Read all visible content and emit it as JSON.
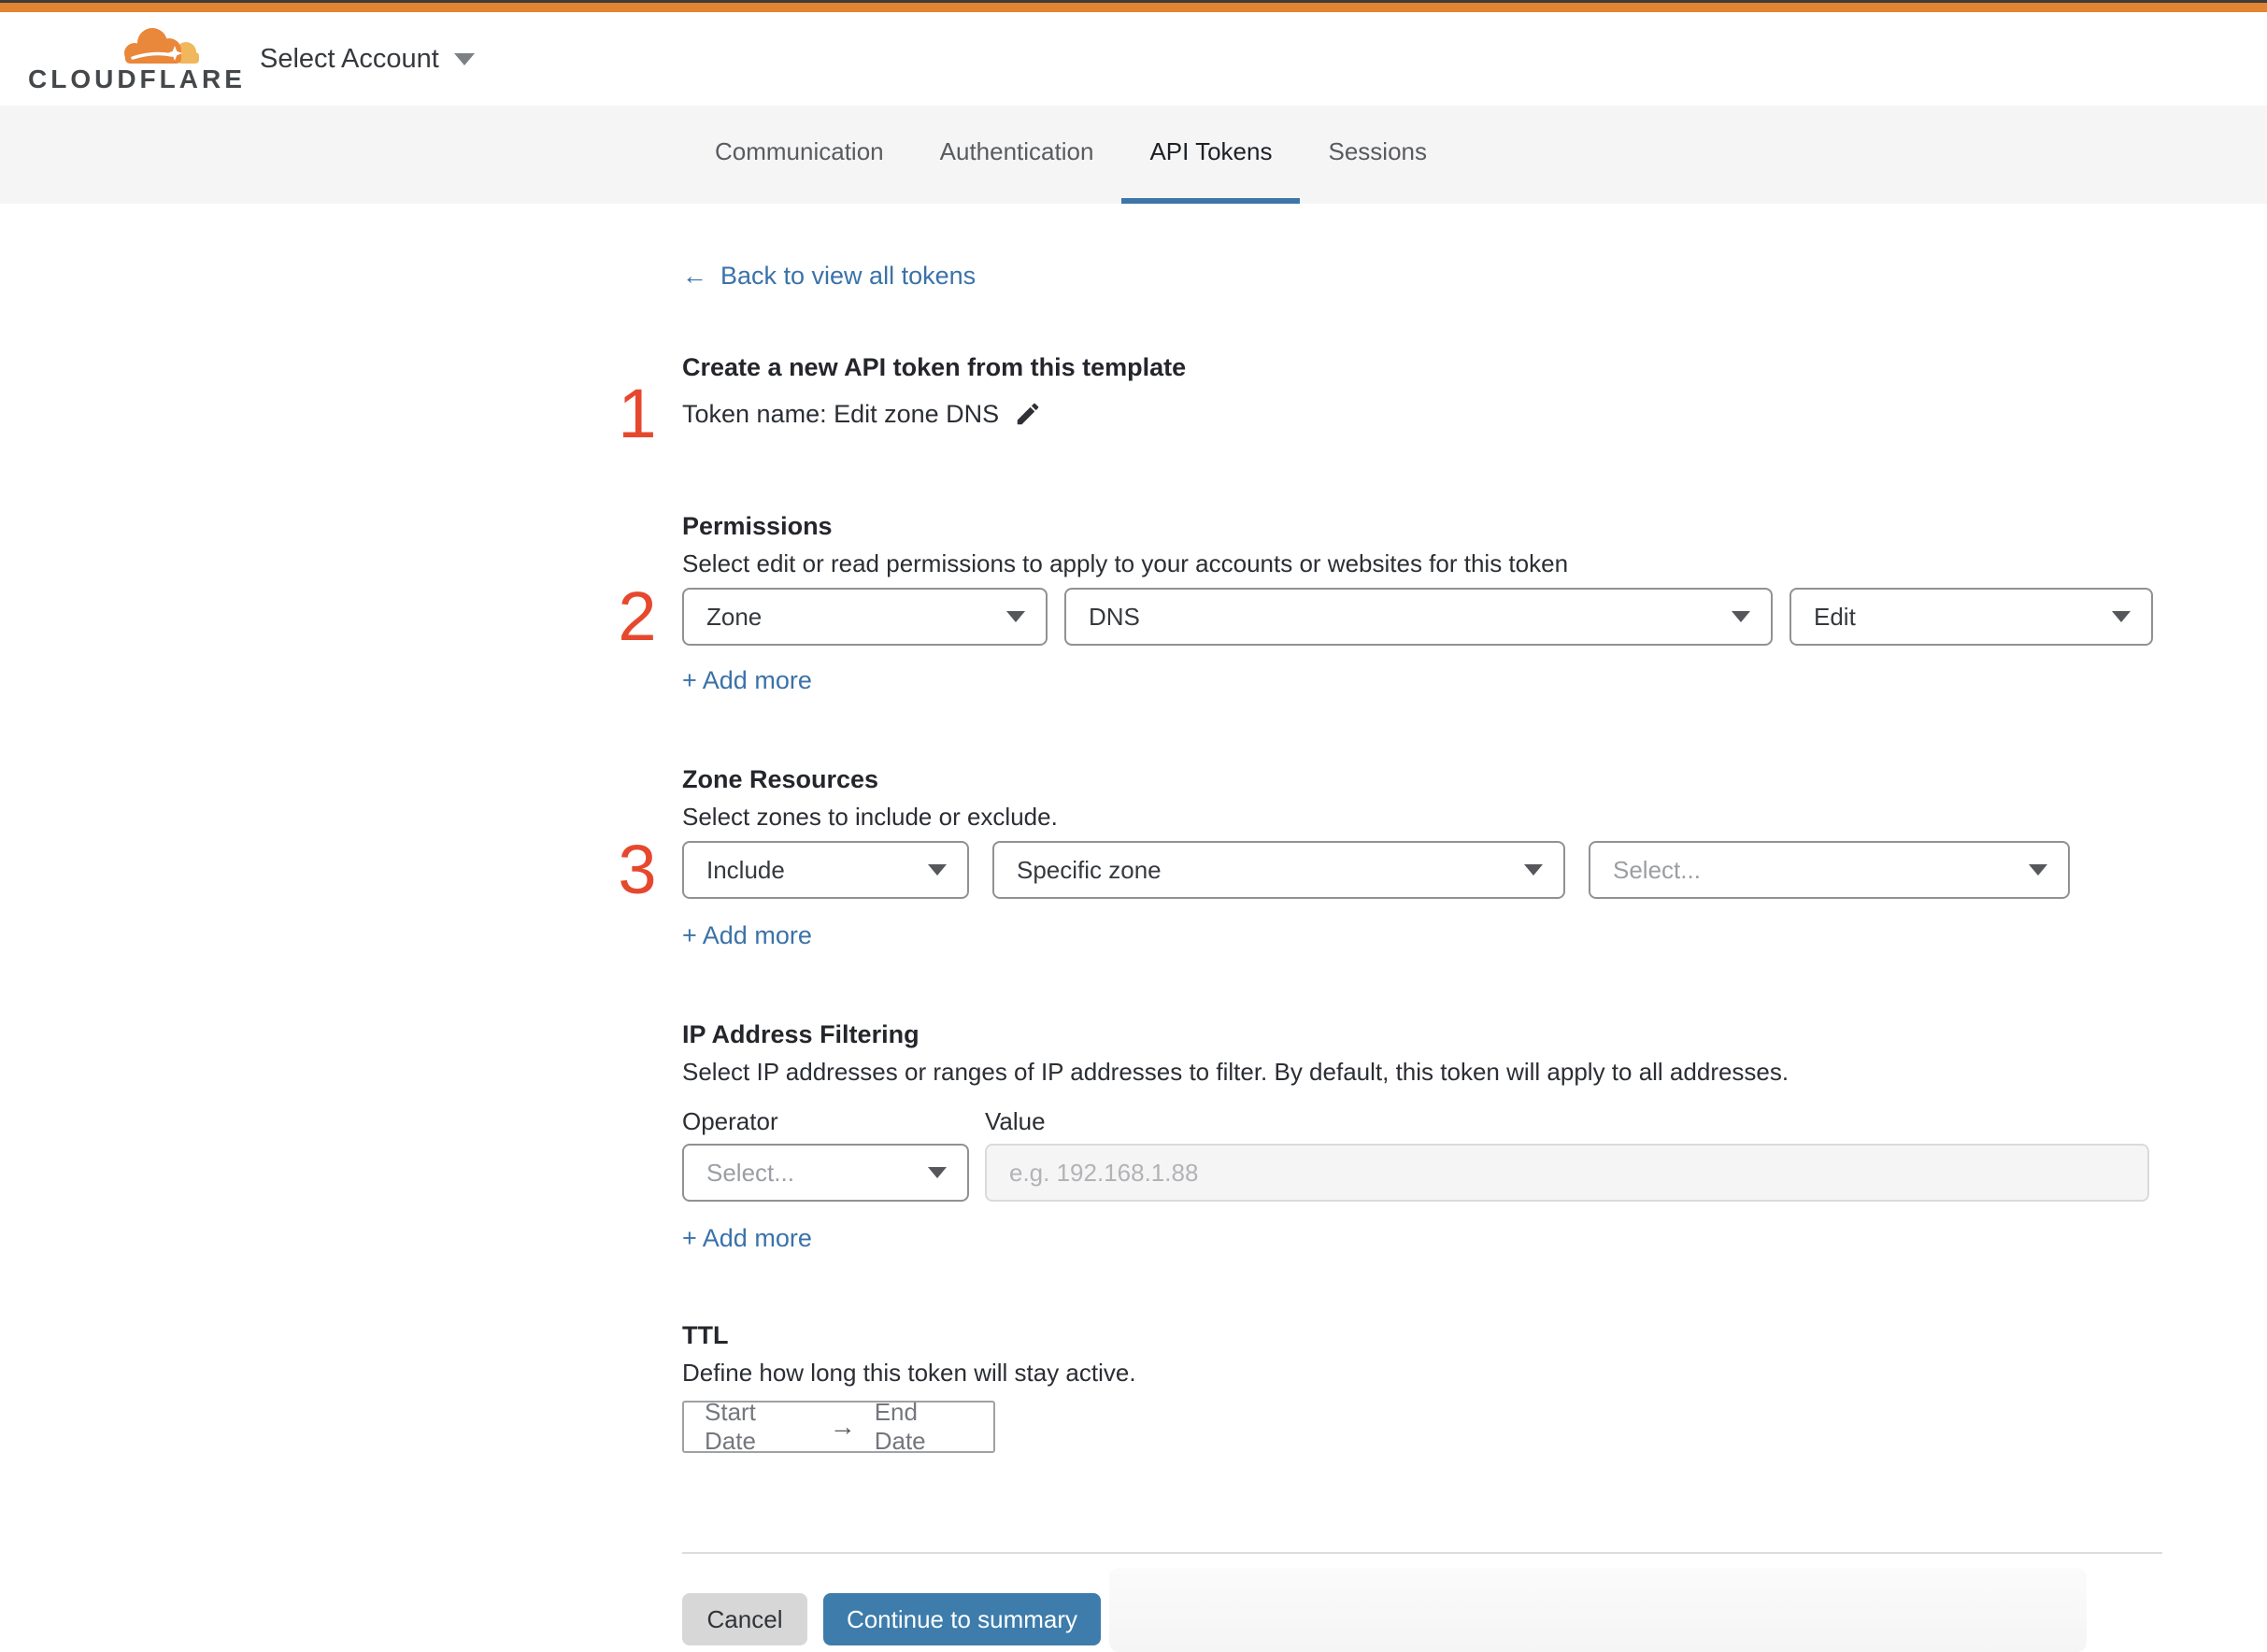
{
  "header": {
    "logo_text": "CLOUDFLARE",
    "account_selector": "Select Account"
  },
  "tabs": [
    {
      "label": "Communication",
      "active": false
    },
    {
      "label": "Authentication",
      "active": false
    },
    {
      "label": "API Tokens",
      "active": true
    },
    {
      "label": "Sessions",
      "active": false
    }
  ],
  "back_link": {
    "arrow": "←",
    "label": "Back to view all tokens"
  },
  "steps": {
    "one": "1",
    "two": "2",
    "three": "3"
  },
  "token_section": {
    "title": "Create a new API token from this template",
    "token_name": "Token name: Edit zone DNS"
  },
  "permissions": {
    "title": "Permissions",
    "description": "Select edit or read permissions to apply to your accounts or websites for this token",
    "selects": [
      "Zone",
      "DNS",
      "Edit"
    ],
    "add_more": "+ Add more"
  },
  "zone_resources": {
    "title": "Zone Resources",
    "description": "Select zones to include or exclude.",
    "selects": [
      "Include",
      "Specific zone",
      "Select..."
    ],
    "add_more": "+ Add more"
  },
  "ip_filtering": {
    "title": "IP Address Filtering",
    "description": "Select IP addresses or ranges of IP addresses to filter. By default, this token will apply to all addresses.",
    "operator_label": "Operator",
    "value_label": "Value",
    "operator_value": "Select...",
    "value_placeholder": "e.g. 192.168.1.88",
    "add_more": "+ Add more"
  },
  "ttl": {
    "title": "TTL",
    "description": "Define how long this token will stay active.",
    "start": "Start Date",
    "arrow": "→",
    "end": "End Date"
  },
  "footer": {
    "cancel": "Cancel",
    "continue": "Continue to summary"
  },
  "colors": {
    "brand_orange": "#e28431",
    "topbar_dark": "#3d3d3b",
    "accent_blue": "#3a72a9",
    "tab_underline": "#3e76a7",
    "step_red": "#e6482e",
    "button_blue": "#3d7cab",
    "button_gray": "#d7d7d7",
    "tabbar_bg": "#f5f5f6"
  }
}
